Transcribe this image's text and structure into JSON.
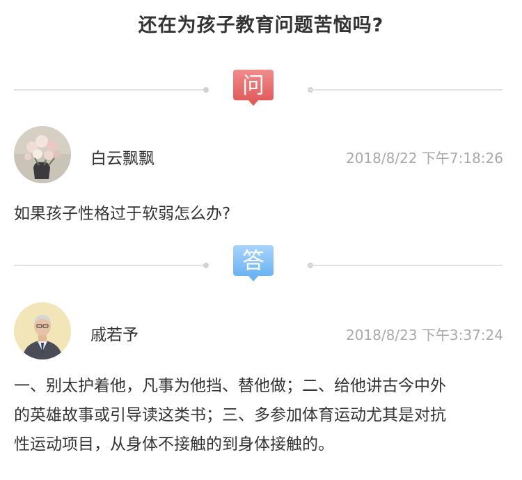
{
  "title": "还在为孩子教育问题苦恼吗?",
  "question": {
    "badge": "问",
    "user_name": "白云飘飘",
    "time": "2018/8/22 下午7:18:26",
    "text": "如果孩子性格过于软弱怎么办?"
  },
  "answer": {
    "badge": "答",
    "user_name": "戚若予",
    "time": "2018/8/23 下午3:37:24",
    "lines": [
      "一、别太护着他，凡事为他挡、替他做；二、给他讲古今中外",
      "的英雄故事或引导读这类书；三、多参加体育运动尤其是对抗",
      "性运动项目，从身体不接触的到身体接触的。"
    ]
  },
  "colors": {
    "ask_badge": "#e25c5c",
    "answer_badge": "#6bb3f3",
    "timestamp": "#a9a9a9"
  }
}
